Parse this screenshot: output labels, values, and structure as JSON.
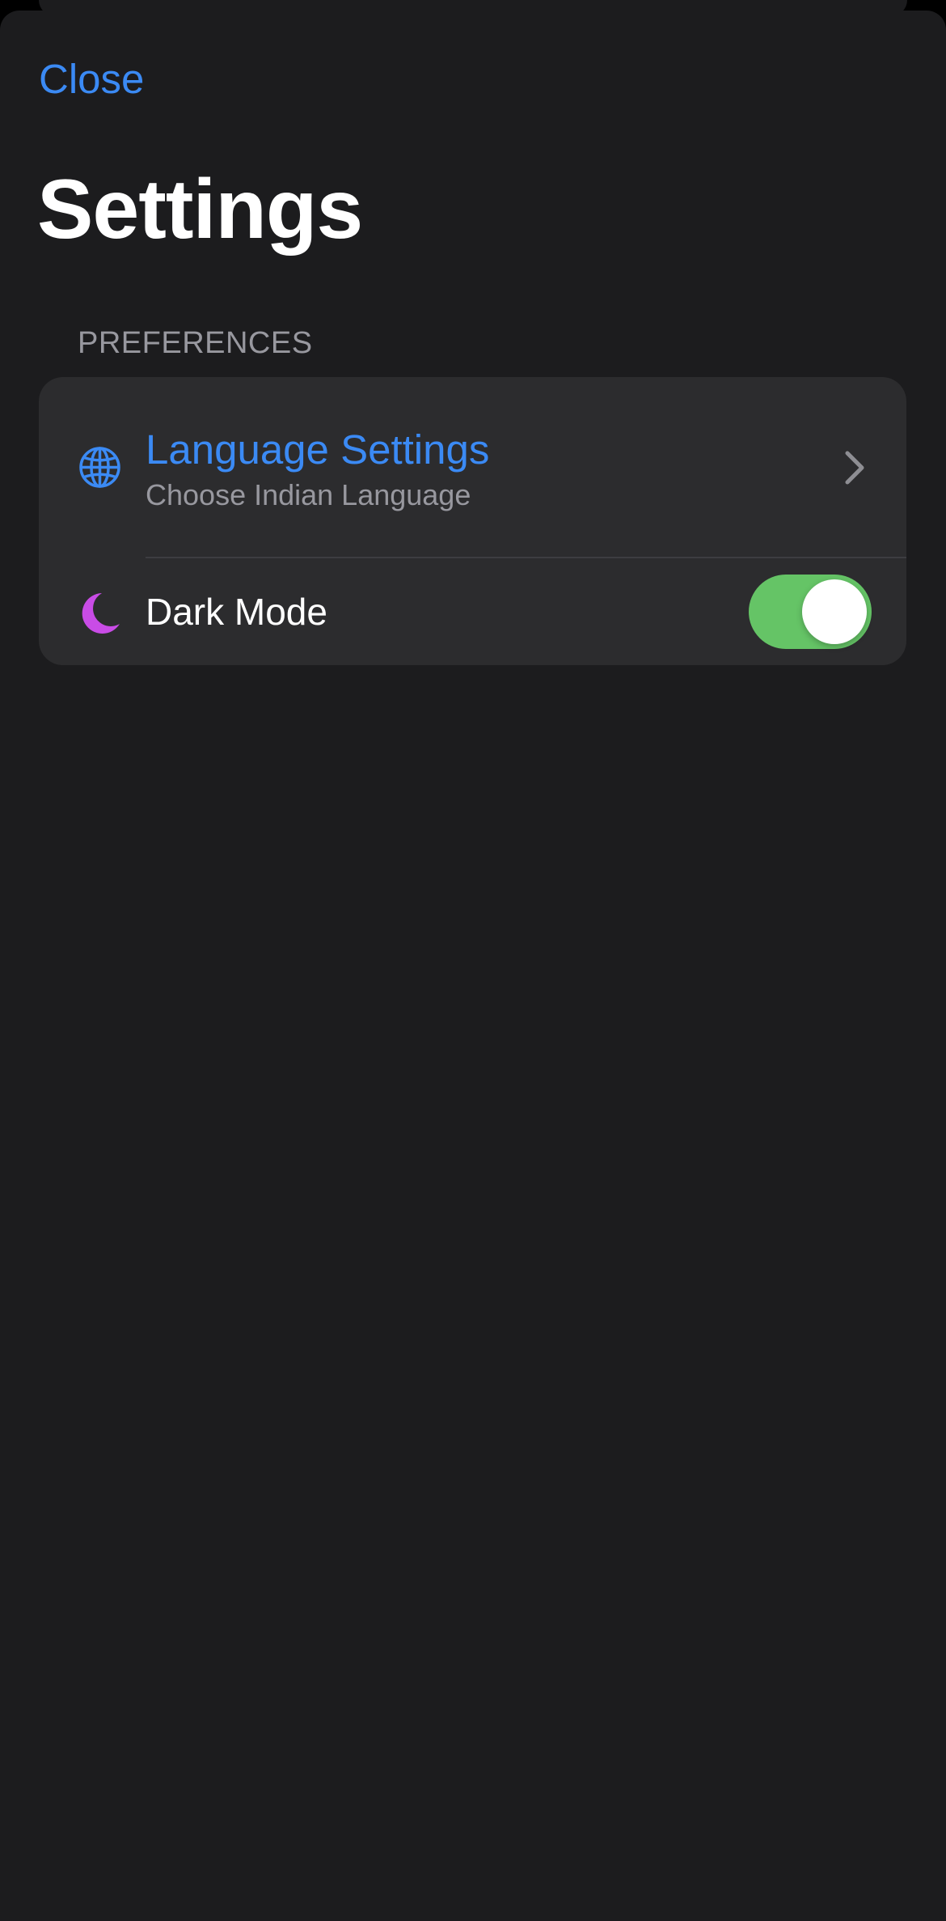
{
  "header": {
    "close_label": "Close",
    "title": "Settings"
  },
  "preferences": {
    "section_label": "PREFERENCES",
    "language": {
      "title": "Language Settings",
      "subtitle": "Choose Indian Language",
      "icon": "globe-icon",
      "accessory_icon": "chevron-right-icon"
    },
    "dark_mode": {
      "label": "Dark Mode",
      "icon": "moon-icon",
      "enabled": true
    }
  },
  "colors": {
    "accent_blue": "#3b8af4",
    "moon_purple": "#c94ce6",
    "toggle_on": "#65c466",
    "sheet_background": "#1c1c1e",
    "group_background": "#2c2c2e",
    "secondary_text": "#98989f"
  }
}
